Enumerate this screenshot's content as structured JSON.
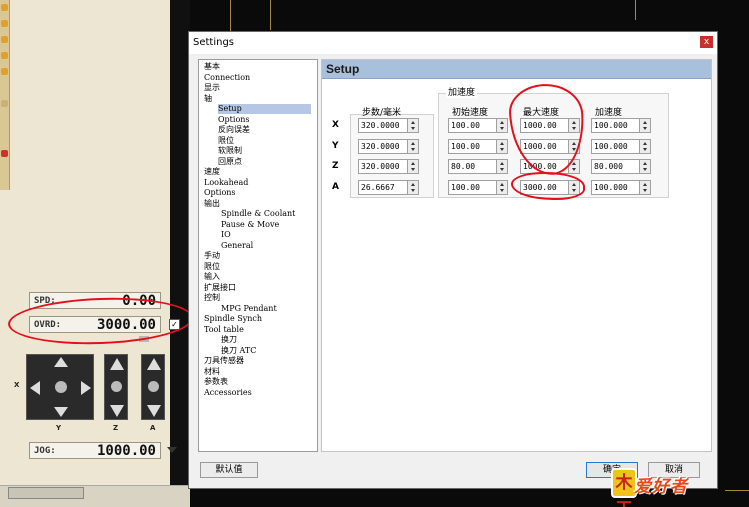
{
  "background_app": {
    "readouts": {
      "spd": {
        "label": "SPD:",
        "value": "0.00"
      },
      "ovrd": {
        "label": "OVRD:",
        "value": "3000.00"
      },
      "jog": {
        "label": "JOG:",
        "value": "1000.00"
      }
    },
    "axis_labels": {
      "x": "X",
      "y": "Y",
      "z": "Z",
      "a": "A"
    }
  },
  "dialog": {
    "title": "Settings",
    "close_glyph": "x",
    "tree": [
      {
        "label": "基本",
        "indent": 0
      },
      {
        "label": "Connection",
        "indent": 0
      },
      {
        "label": "显示",
        "indent": 0
      },
      {
        "label": "轴",
        "indent": 0
      },
      {
        "label": "Setup",
        "indent": 2,
        "selected": true
      },
      {
        "label": "Options",
        "indent": 2
      },
      {
        "label": "反向误差",
        "indent": 2
      },
      {
        "label": "限位",
        "indent": 2
      },
      {
        "label": "软限制",
        "indent": 2
      },
      {
        "label": "回原点",
        "indent": 2
      },
      {
        "label": "速度",
        "indent": 0
      },
      {
        "label": "Lookahead",
        "indent": 0
      },
      {
        "label": "Options",
        "indent": 0
      },
      {
        "label": "输出",
        "indent": 0
      },
      {
        "label": "Spindle & Coolant",
        "indent": 1
      },
      {
        "label": "Pause & Move",
        "indent": 1
      },
      {
        "label": "IO",
        "indent": 1
      },
      {
        "label": "General",
        "indent": 1
      },
      {
        "label": "手动",
        "indent": 0
      },
      {
        "label": "限位",
        "indent": 0
      },
      {
        "label": "输入",
        "indent": 0
      },
      {
        "label": "扩展接口",
        "indent": 0
      },
      {
        "label": "控制",
        "indent": 0
      },
      {
        "label": "MPG Pendant",
        "indent": 1
      },
      {
        "label": "Spindle Synch",
        "indent": 0
      },
      {
        "label": "Tool table",
        "indent": 0
      },
      {
        "label": "换刀",
        "indent": 1
      },
      {
        "label": "换刀 ATC",
        "indent": 1
      },
      {
        "label": "刀具传感器",
        "indent": 0
      },
      {
        "label": "材料",
        "indent": 0
      },
      {
        "label": "参数表",
        "indent": 0
      },
      {
        "label": "Accessories",
        "indent": 0
      }
    ],
    "panel": {
      "title": "Setup",
      "accel_group_title": "加速度",
      "columns": [
        "步数/毫米",
        "初始速度",
        "最大速度",
        "加速度"
      ],
      "rows": [
        {
          "axis": "X",
          "steps_per_mm": "320.0000",
          "initial_speed": "100.00",
          "max_speed": "1000.00",
          "acceleration": "100.000"
        },
        {
          "axis": "Y",
          "steps_per_mm": "320.0000",
          "initial_speed": "100.00",
          "max_speed": "1000.00",
          "acceleration": "100.000"
        },
        {
          "axis": "Z",
          "steps_per_mm": "320.0000",
          "initial_speed": "80.00",
          "max_speed": "1000.00",
          "acceleration": "80.000"
        },
        {
          "axis": "A",
          "steps_per_mm": "26.6667",
          "initial_speed": "100.00",
          "max_speed": "3000.00",
          "acceleration": "100.000"
        }
      ]
    },
    "buttons": {
      "default": "默认值",
      "ok": "确定",
      "cancel": "取消"
    }
  },
  "watermark": {
    "badge": "木工",
    "text": "爱好者"
  },
  "colors": {
    "annotation_red": "#e3101c",
    "panel_header": "#a9c0dc",
    "selection": "#b5c7e4"
  }
}
